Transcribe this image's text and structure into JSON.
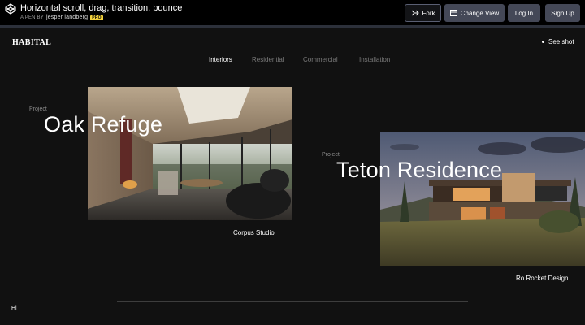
{
  "codepen": {
    "title": "Horizontal scroll, drag, transition, bounce",
    "byline_prefix": "A PEN BY",
    "author": "jesper landberg",
    "badge": "PRO",
    "buttons": {
      "fork": "Fork",
      "change_view": "Change View",
      "login": "Log In",
      "signup": "Sign Up"
    }
  },
  "site": {
    "brand": "HABITAL",
    "see_shot": "See shot",
    "nav": [
      "Interiors",
      "Residential",
      "Commercial",
      "Installation"
    ],
    "active_nav": "Interiors",
    "projects": [
      {
        "label": "Project",
        "title": "Oak Refuge",
        "studio": "Corpus Studio"
      },
      {
        "label": "Project",
        "title": "Teton Residence",
        "studio": "Ro Rocket Design"
      }
    ],
    "footer_text": "Hi"
  },
  "colors": {
    "header_bg": "#000000",
    "site_bg": "#111111",
    "button_bg": "#444857",
    "pro_badge": "#f5d33d",
    "nav_inactive": "#7a7a7a"
  },
  "icons": {
    "logo": "codepen-logo-icon",
    "fork": "fork-icon",
    "change_view": "layout-icon",
    "see_shot": "dot-icon"
  }
}
